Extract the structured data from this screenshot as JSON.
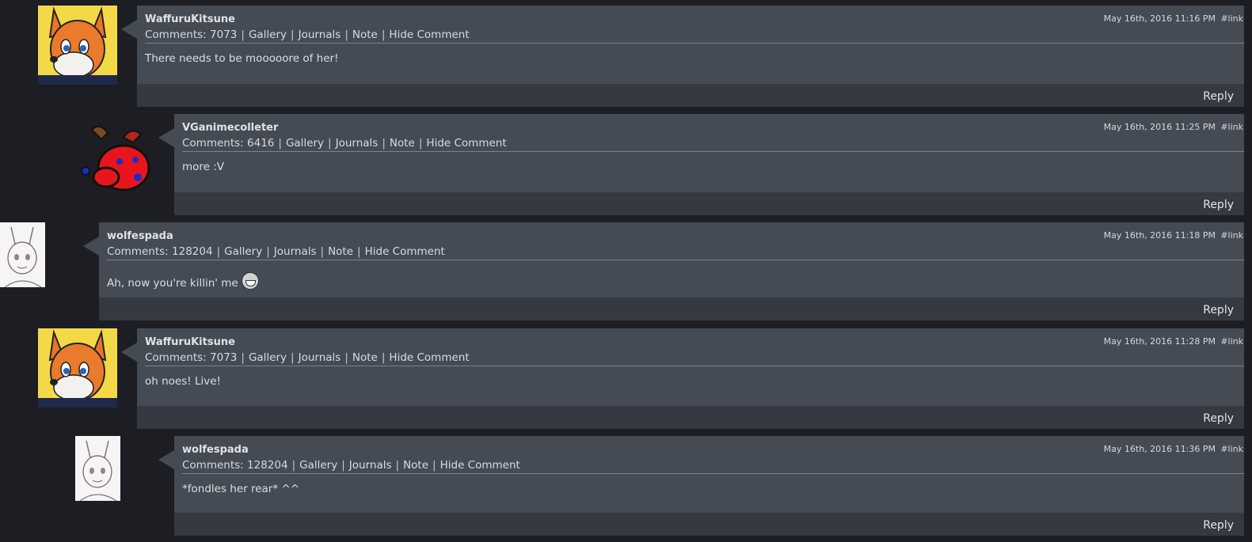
{
  "comments": [
    {
      "username": "WaffuruKitsune",
      "comments_label": "Comments: 7073",
      "links": [
        "Gallery",
        "Journals",
        "Note",
        "Hide Comment"
      ],
      "date": "May 16th, 2016 11:16 PM",
      "permalink": "#link",
      "text": "There needs to be mooooore of her!",
      "reply": "Reply",
      "avatar": "fox-avatar"
    },
    {
      "username": "VGanimecolleter",
      "comments_label": "Comments: 6416",
      "links": [
        "Gallery",
        "Journals",
        "Note",
        "Hide Comment"
      ],
      "date": "May 16th, 2016 11:25 PM",
      "permalink": "#link",
      "text": "more :V",
      "reply": "Reply",
      "avatar": "red-blob-avatar"
    },
    {
      "username": "wolfespada",
      "comments_label": "Comments: 128204",
      "links": [
        "Gallery",
        "Journals",
        "Note",
        "Hide Comment"
      ],
      "date": "May 16th, 2016 11:18 PM",
      "permalink": "#link",
      "text": "Ah, now you're killin' me",
      "reply": "Reply",
      "avatar": "sketch-avatar"
    },
    {
      "username": "WaffuruKitsune",
      "comments_label": "Comments: 7073",
      "links": [
        "Gallery",
        "Journals",
        "Note",
        "Hide Comment"
      ],
      "date": "May 16th, 2016 11:28 PM",
      "permalink": "#link",
      "text": "oh noes! Live!",
      "reply": "Reply",
      "avatar": "fox-avatar"
    },
    {
      "username": "wolfespada",
      "comments_label": "Comments: 128204",
      "links": [
        "Gallery",
        "Journals",
        "Note",
        "Hide Comment"
      ],
      "date": "May 16th, 2016 11:36 PM",
      "permalink": "#link",
      "text": "*fondles her rear* ^^",
      "reply": "Reply",
      "avatar": "sketch-avatar"
    }
  ],
  "colors": {
    "page_bg": "#1d1e23",
    "comment_bg": "#454b54",
    "footer_bg": "#353a42"
  }
}
